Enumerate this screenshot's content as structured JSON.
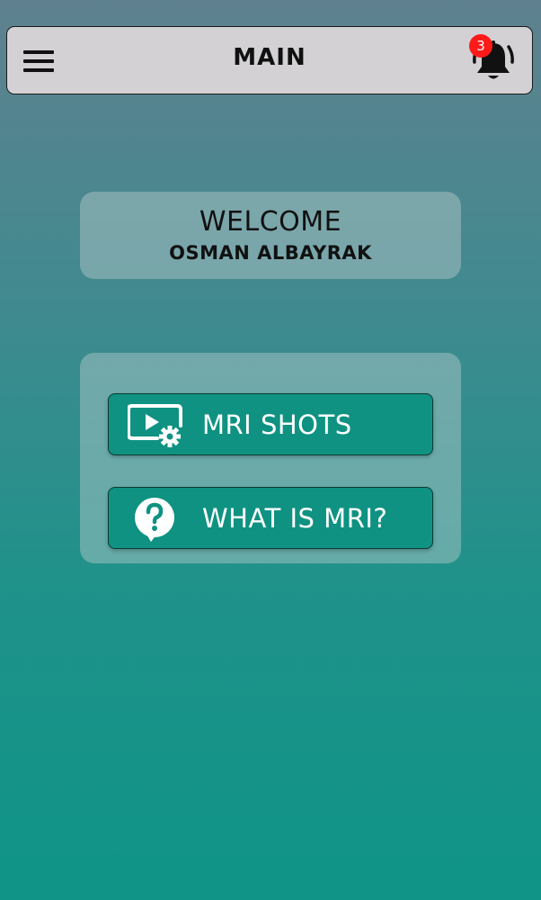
{
  "header": {
    "title": "MAIN",
    "menu_icon": "hamburger-menu-icon",
    "notifications_icon": "bell-icon",
    "notification_count": "3",
    "badge_color": "#ff1a1a"
  },
  "welcome": {
    "title": "WELCOME",
    "name": "OSMAN ALBAYRAK"
  },
  "actions": [
    {
      "label": "MRI SHOTS",
      "icon": "video-settings-icon"
    },
    {
      "label": "WHAT IS MRI?",
      "icon": "question-bubble-icon"
    }
  ],
  "colors": {
    "button": "#0f9282",
    "header_bg": "#d3d1d4",
    "gradient_top": "#5f818f",
    "gradient_bottom": "#0f9487"
  }
}
